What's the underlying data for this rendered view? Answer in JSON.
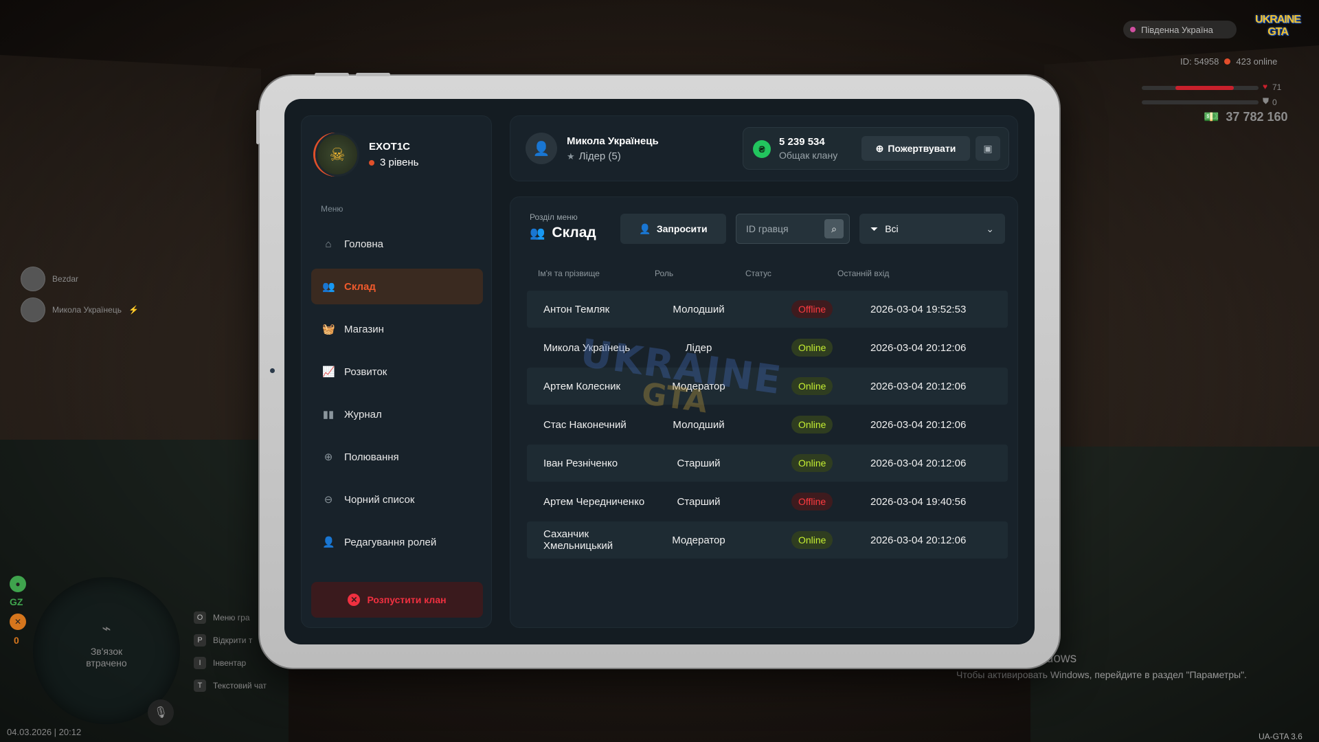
{
  "hud": {
    "server": "Південна Україна",
    "logo": "UKRAINE GTA",
    "player_id": "ID: 54958",
    "online": "423 online",
    "health_value": "71",
    "armor_value": "0",
    "money": "37 782 160"
  },
  "voice": [
    {
      "name": "Bezdar"
    },
    {
      "name": "Микола Українець"
    }
  ],
  "radar": {
    "status": "Зв'язок втрачено",
    "gz_label": "GZ",
    "zero_label": "0"
  },
  "keys": [
    {
      "key": "O",
      "label": "Меню гра"
    },
    {
      "key": "P",
      "label": "Відкрити т"
    },
    {
      "key": "I",
      "label": "Інвентар"
    },
    {
      "key": "T",
      "label": "Текстовий чат"
    }
  ],
  "datetime": "04.03.2026 | 20:12",
  "version": "UA-GTA 3.6",
  "windows": {
    "title": "Активация Windows",
    "subtitle": "Чтобы активировать Windows, перейдите в раздел \"Параметры\"."
  },
  "clan": {
    "name": "EXOT1C",
    "level": "3 рівень"
  },
  "menu": {
    "label": "Меню",
    "items": [
      {
        "label": "Головна",
        "icon": "home-icon"
      },
      {
        "label": "Склад",
        "icon": "members-icon"
      },
      {
        "label": "Магазин",
        "icon": "shop-icon"
      },
      {
        "label": "Розвиток",
        "icon": "chart-icon"
      },
      {
        "label": "Журнал",
        "icon": "book-icon"
      },
      {
        "label": "Полювання",
        "icon": "target-icon"
      },
      {
        "label": "Чорний список",
        "icon": "block-icon"
      },
      {
        "label": "Редагування ролей",
        "icon": "user-edit-icon"
      }
    ],
    "disband": "Розпустити клан"
  },
  "user": {
    "name": "Микола Українець",
    "role": "Лідер (5)"
  },
  "bank": {
    "amount": "5 239 534",
    "label": "Общак клану",
    "donate": "Пожертвувати"
  },
  "section": {
    "label": "Розділ меню",
    "title": "Склад",
    "invite": "Запросити",
    "search_placeholder": "ID гравця",
    "filter": "Всі"
  },
  "table": {
    "headers": [
      "Ім'я та прізвище",
      "Роль",
      "Статус",
      "Останній вхід"
    ],
    "rows": [
      {
        "name": "Антон Темляк",
        "role": "Молодший",
        "status": "Offline",
        "last": "2026-03-04 19:52:53"
      },
      {
        "name": "Микола Українець",
        "role": "Лідер",
        "status": "Online",
        "last": "2026-03-04 20:12:06"
      },
      {
        "name": "Артем Колесник",
        "role": "Модератор",
        "status": "Online",
        "last": "2026-03-04 20:12:06"
      },
      {
        "name": "Стас Наконечний",
        "role": "Молодший",
        "status": "Online",
        "last": "2026-03-04 20:12:06"
      },
      {
        "name": "Іван Резніченко",
        "role": "Старший",
        "status": "Online",
        "last": "2026-03-04 20:12:06"
      },
      {
        "name": "Артем Чередниченко",
        "role": "Старший",
        "status": "Offline",
        "last": "2026-03-04 19:40:56"
      },
      {
        "name": "Саханчик Хмельницький",
        "role": "Модератор",
        "status": "Online",
        "last": "2026-03-04 20:12:06"
      }
    ]
  },
  "colors": {
    "accent": "#f05a2c",
    "online": "#c6f032",
    "offline": "#ff3b40",
    "coin": "#22c55e"
  }
}
